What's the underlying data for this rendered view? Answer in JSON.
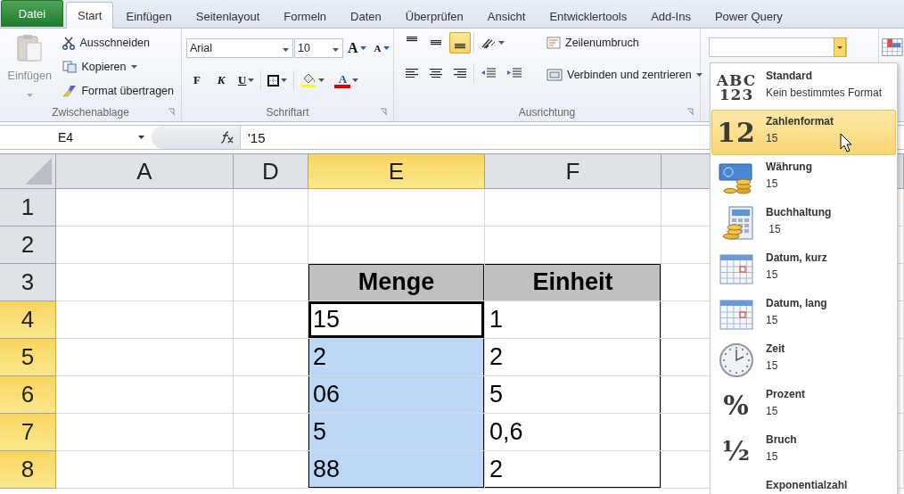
{
  "tabs": [
    {
      "label": "Datei",
      "kind": "file",
      "selected": false
    },
    {
      "label": "Start",
      "kind": "tab",
      "selected": true
    },
    {
      "label": "Einfügen",
      "kind": "tab",
      "selected": false
    },
    {
      "label": "Seitenlayout",
      "kind": "tab",
      "selected": false
    },
    {
      "label": "Formeln",
      "kind": "tab",
      "selected": false
    },
    {
      "label": "Daten",
      "kind": "tab",
      "selected": false
    },
    {
      "label": "Überprüfen",
      "kind": "tab",
      "selected": false
    },
    {
      "label": "Ansicht",
      "kind": "tab",
      "selected": false
    },
    {
      "label": "Entwicklertools",
      "kind": "tab",
      "selected": false
    },
    {
      "label": "Add-Ins",
      "kind": "tab",
      "selected": false
    },
    {
      "label": "Power Query",
      "kind": "tab",
      "selected": false
    }
  ],
  "clipboard": {
    "paste": "Einfügen",
    "paste_disabled": true,
    "cut": "Ausschneiden",
    "copy": "Kopieren",
    "format_painter": "Format übertragen",
    "group": "Zwischenablage"
  },
  "font": {
    "name": "Arial",
    "size": "10",
    "grow": "A",
    "shrink": "A",
    "bold": "F",
    "italic": "K",
    "underline": "U",
    "color_letter": "A",
    "group": "Schriftart"
  },
  "alignment": {
    "vertical": [
      {
        "kind": "top",
        "selected": false
      },
      {
        "kind": "middle",
        "selected": false
      },
      {
        "kind": "bottom",
        "selected": true
      }
    ],
    "wrap": "Zeilenumbruch",
    "merge": "Verbinden und zentrieren",
    "group": "Ausrichtung"
  },
  "formula_bar": {
    "name_box": "E4",
    "formula": "'15"
  },
  "sheet": {
    "columns": [
      {
        "label": "A",
        "selected": false
      },
      {
        "label": "D",
        "selected": false
      },
      {
        "label": "E",
        "selected": true
      },
      {
        "label": "F",
        "selected": false
      }
    ],
    "rows": [
      {
        "label": "1",
        "selected": false
      },
      {
        "label": "2",
        "selected": false
      },
      {
        "label": "3",
        "selected": false,
        "cells": [
          {
            "kind": "header",
            "text": "Menge"
          },
          {
            "kind": "header",
            "text": "Einheit"
          }
        ]
      },
      {
        "label": "4",
        "selected": true,
        "cells": [
          {
            "kind": "value",
            "text": "15",
            "active": true
          },
          {
            "kind": "value",
            "text": "1",
            "selected": false
          }
        ]
      },
      {
        "label": "5",
        "selected": true,
        "cells": [
          {
            "kind": "value",
            "text": "2",
            "selected": true,
            "active": false
          },
          {
            "kind": "value",
            "text": "2",
            "selected": false
          }
        ]
      },
      {
        "label": "6",
        "selected": true,
        "cells": [
          {
            "kind": "value",
            "text": "06",
            "selected": true,
            "active": false
          },
          {
            "kind": "value",
            "text": "5",
            "selected": false
          }
        ]
      },
      {
        "label": "7",
        "selected": true,
        "cells": [
          {
            "kind": "value",
            "text": "5",
            "selected": true,
            "active": false
          },
          {
            "kind": "value",
            "text": "0,6",
            "selected": false
          }
        ]
      },
      {
        "label": "8",
        "selected": true,
        "cells": [
          {
            "kind": "value",
            "text": "88",
            "selected": true,
            "active": false
          },
          {
            "kind": "value",
            "text": "2",
            "selected": false
          }
        ]
      }
    ]
  },
  "format_menu": {
    "items": [
      {
        "kind": "standard",
        "glyph": [
          "ABC",
          "123"
        ],
        "title": "Standard",
        "sample": "Kein bestimmtes Format",
        "selected": false
      },
      {
        "kind": "number",
        "glyph": [
          "12"
        ],
        "title": "Zahlenformat",
        "sample": "15",
        "selected": true
      },
      {
        "kind": "currency",
        "title": "Währung",
        "sample": "15",
        "selected": false
      },
      {
        "kind": "accounting",
        "title": "Buchhaltung",
        "sample": " 15",
        "selected": false
      },
      {
        "kind": "date_short",
        "title": "Datum, kurz",
        "sample": "15",
        "selected": false
      },
      {
        "kind": "date_long",
        "title": "Datum, lang",
        "sample": "15",
        "selected": false
      },
      {
        "kind": "time",
        "title": "Zeit",
        "sample": "15",
        "selected": false
      },
      {
        "kind": "percent",
        "glyph": [
          "%"
        ],
        "title": "Prozent",
        "sample": "15",
        "selected": false
      },
      {
        "kind": "fraction",
        "glyph": [
          "½"
        ],
        "title": "Bruch",
        "sample": "15",
        "selected": false
      },
      {
        "kind": "scientific",
        "title": "Exponentialzahl",
        "selected": false
      }
    ]
  }
}
